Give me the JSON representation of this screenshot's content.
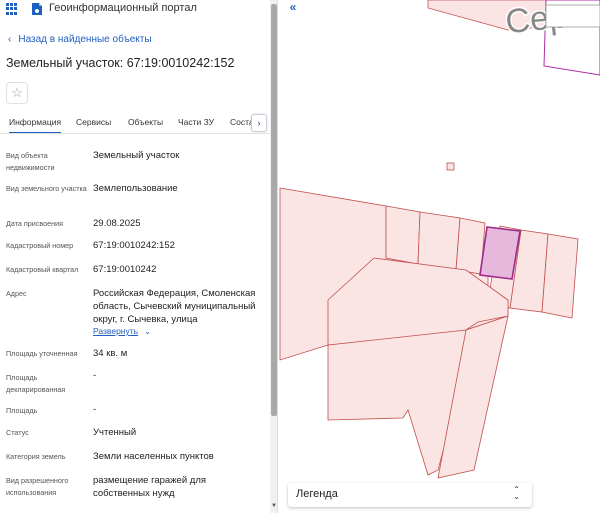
{
  "app": {
    "title": "Геоинформационный портал"
  },
  "nav": {
    "back_label": "Назад в найденные объекты"
  },
  "page": {
    "title": "Земельный участок: 67:19:0010242:152"
  },
  "tabs": [
    {
      "label": "Информация"
    },
    {
      "label": "Сервисы"
    },
    {
      "label": "Объекты"
    },
    {
      "label": "Части ЗУ"
    },
    {
      "label": "Состав"
    }
  ],
  "properties": [
    {
      "label": "Вид объекта недвижимости",
      "value": "Земельный участок"
    },
    {
      "label": "Вид земельного участка",
      "value": "Землепользование"
    },
    {
      "label": "Дата присвоения",
      "value": "29.08.2025"
    },
    {
      "label": "Кадастровый номер",
      "value": "67:19:0010242:152"
    },
    {
      "label": "Кадастровый квартал",
      "value": "67:19:0010242"
    },
    {
      "label": "Адрес",
      "value": "Российская Федерация, Смоленская область, Сычевский муниципальный округ, г. Сычевка, улица"
    },
    {
      "label": "Площадь уточненная",
      "value": "34 кв. м"
    },
    {
      "label": "Площадь декларированная",
      "value": "-"
    },
    {
      "label": "Площадь",
      "value": "-"
    },
    {
      "label": "Статус",
      "value": "Учтенный"
    },
    {
      "label": "Категория земель",
      "value": "Земли населенных пунктов"
    },
    {
      "label": "Вид разрешенного использования",
      "value": "размещение гаражей для собственных нужд"
    }
  ],
  "address_expand_label": "Развернуть",
  "map": {
    "street_label": "Сер",
    "legend_label": "Легенда",
    "parcel_fill": "#fbe4e4",
    "parcel_stroke": "#c0504d",
    "selected_fill": "#e6b8dc",
    "selected_stroke": "#9b2a8a",
    "accent": "#1f5fbf"
  },
  "icons": {
    "apps": "grid-icon",
    "logo": "portal-logo-icon",
    "back": "chevron-left-icon",
    "favorite": "star-icon",
    "tab_next": "chevron-right-icon",
    "expand": "chevron-down-icon",
    "collapse": "double-chevron-left-icon",
    "legend_select": "updown-icon"
  }
}
